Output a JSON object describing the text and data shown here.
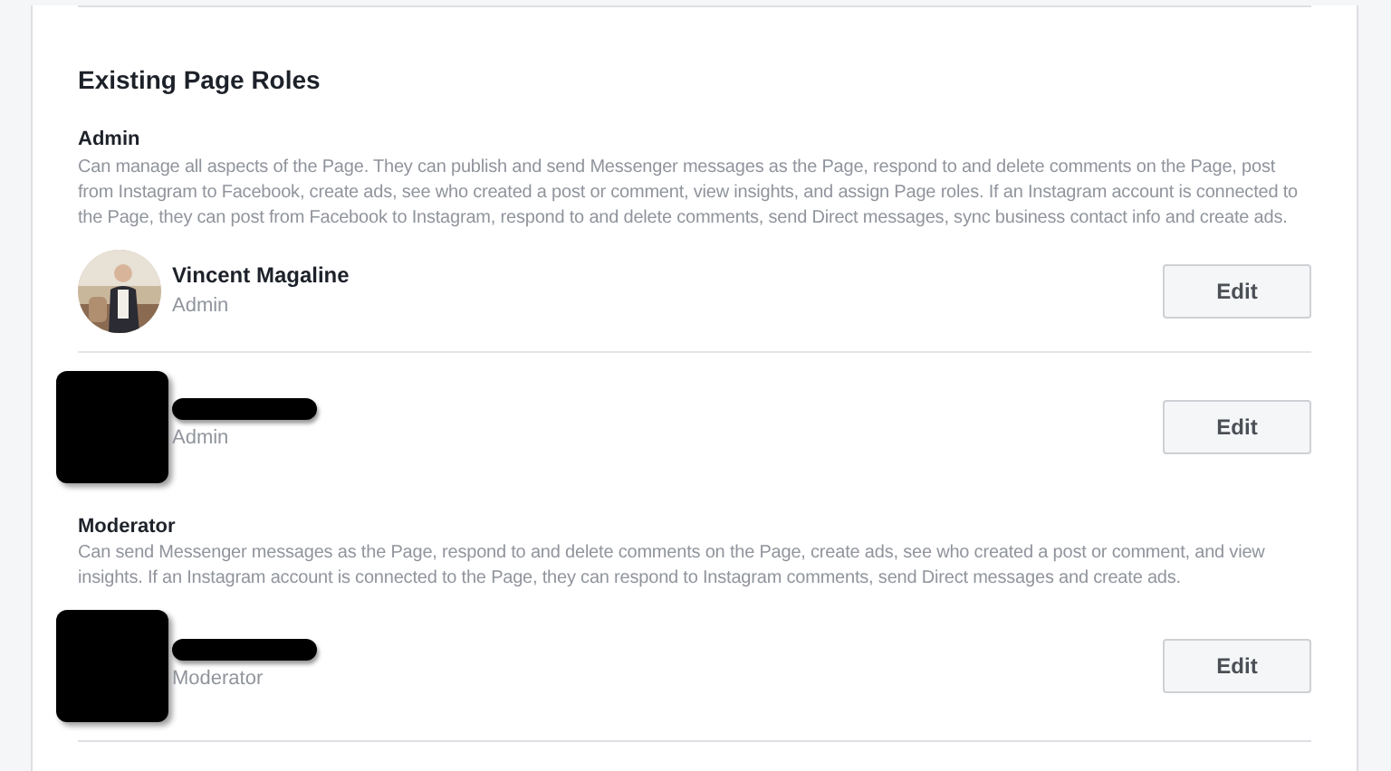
{
  "title": "Existing Page Roles",
  "sections": [
    {
      "role": "Admin",
      "description": "Can manage all aspects of the Page. They can publish and send Messenger messages as the Page, respond to and delete comments on the Page, post from Instagram to Facebook, create ads, see who created a post or comment, view insights, and assign Page roles. If an Instagram account is connected to the Page, they can post from Facebook to Instagram, respond to and delete comments, send Direct messages, sync business contact info and create ads.",
      "members": [
        {
          "redacted": false,
          "name": "Vincent Magaline",
          "role": "Admin",
          "button": "Edit"
        },
        {
          "redacted": true,
          "role": "Admin",
          "button": "Edit"
        }
      ]
    },
    {
      "role": "Moderator",
      "description": "Can send Messenger messages as the Page, respond to and delete comments on the Page, create ads, see who created a post or comment, and view insights. If an Instagram account is connected to the Page, they can respond to Instagram comments, send Direct messages and create ads.",
      "members": [
        {
          "redacted": true,
          "role": "Moderator",
          "button": "Edit"
        }
      ]
    }
  ]
}
